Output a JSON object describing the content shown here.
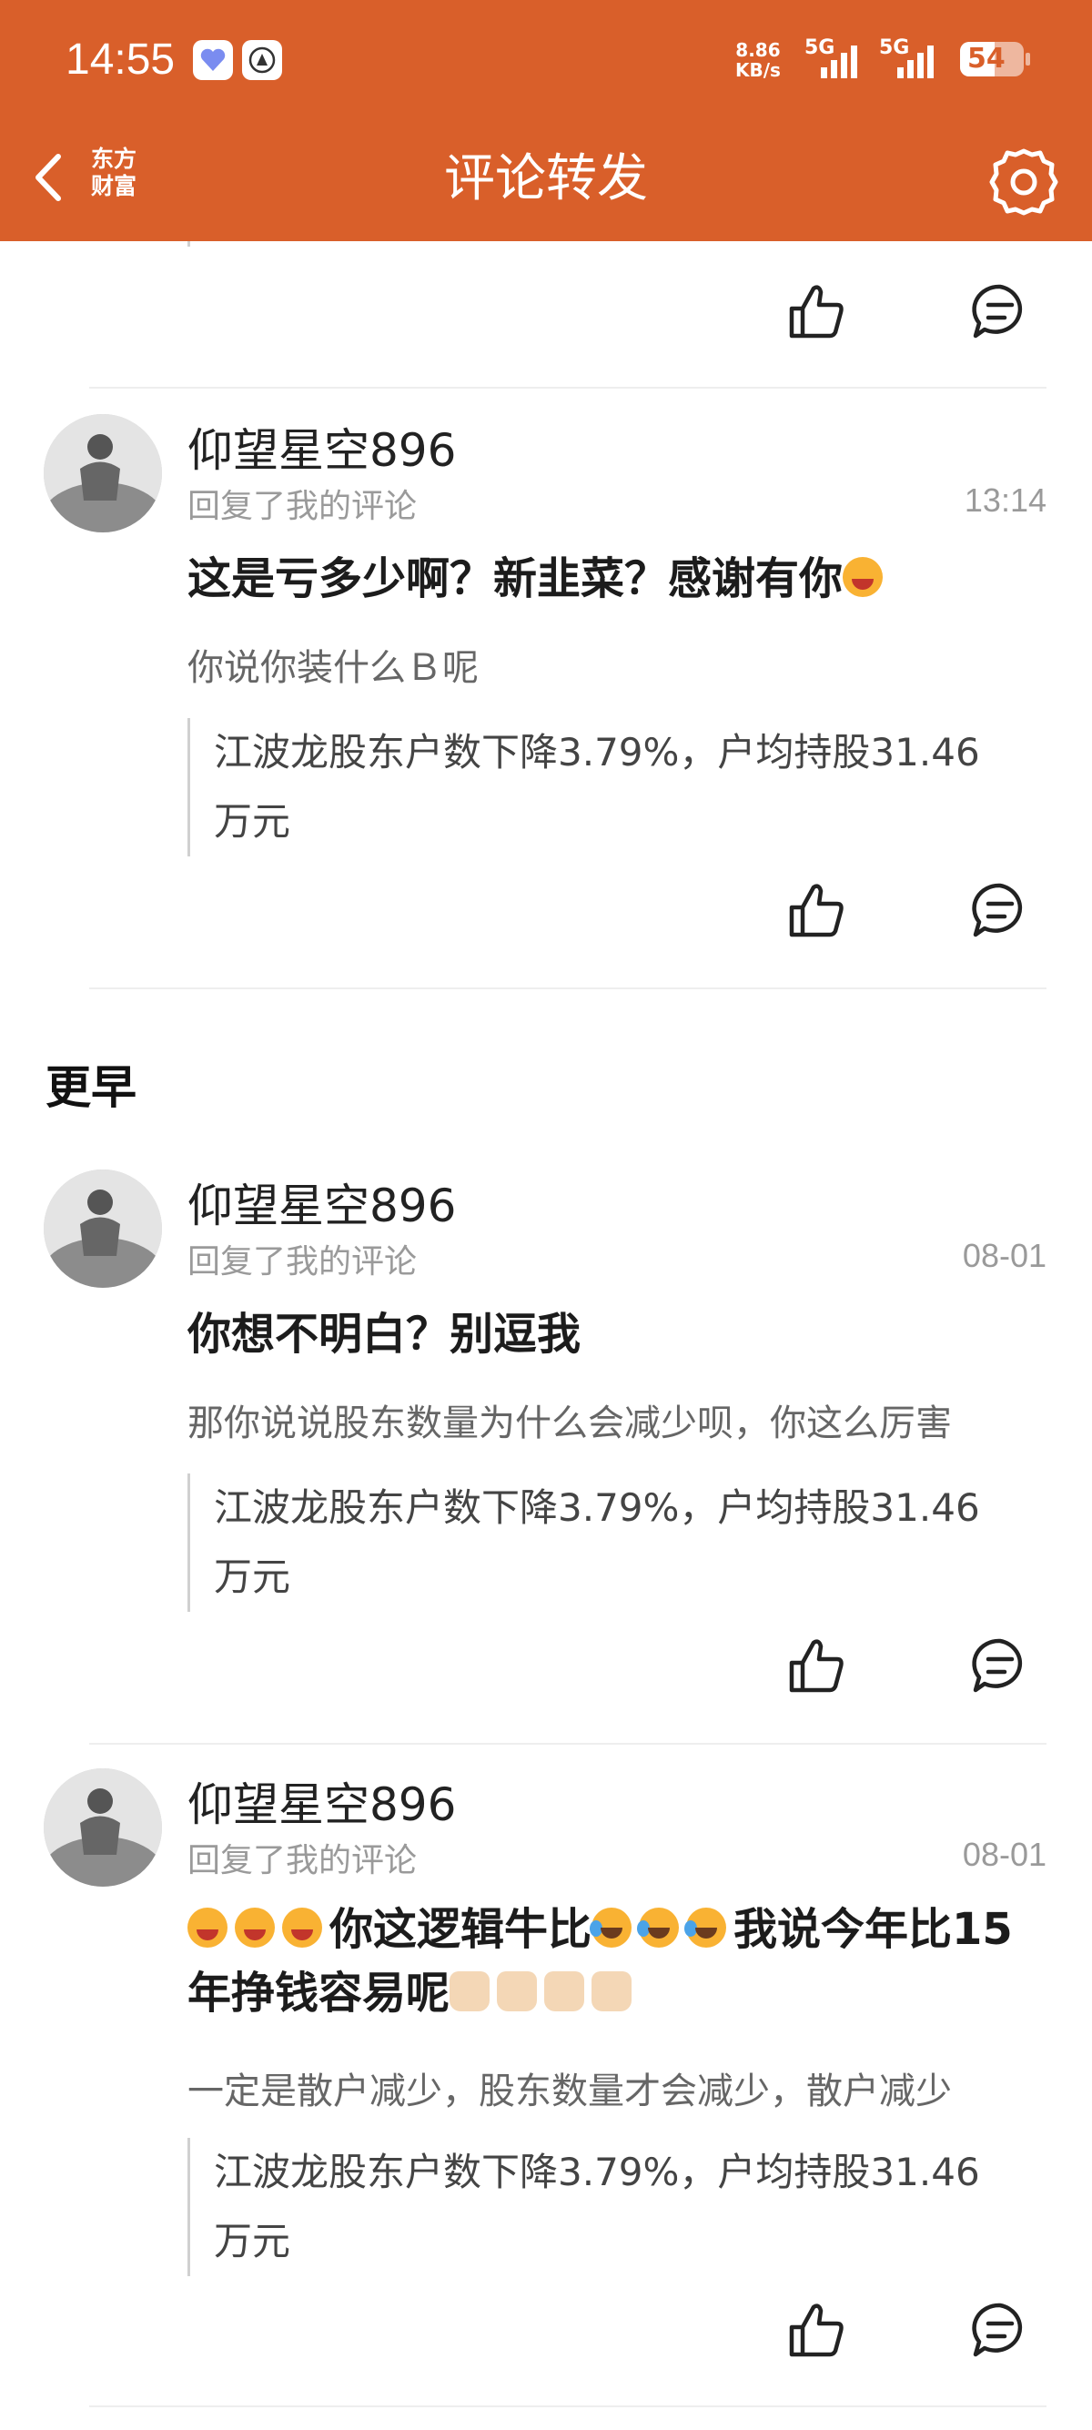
{
  "status_bar": {
    "time": "14:55",
    "net_speed_line1": "8.86",
    "net_speed_line2": "KB/s",
    "signal1_label": "5G",
    "signal2_label": "5G",
    "battery": "54"
  },
  "header": {
    "title": "评论转发",
    "logo_line1": "东方",
    "logo_line2": "财富",
    "accent_color": "#D95F2A"
  },
  "section_earlier": "更早",
  "comments": [
    {
      "name": "仰望星空896",
      "subtitle": "回复了我的评论",
      "date": "13:14",
      "reply": "这是亏多少啊？新韭菜？感谢有你",
      "original": "你说你装什么Ｂ呢",
      "quote_line1": "江波龙股东户数下降3.79%，户均持股31.46",
      "quote_line2": "万元"
    },
    {
      "name": "仰望星空896",
      "subtitle": "回复了我的评论",
      "date": "08-01",
      "reply": "你想不明白？别逗我",
      "original": "那你说说股东数量为什么会减少呗，你这么厉害",
      "quote_line1": "江波龙股东户数下降3.79%，户均持股31.46",
      "quote_line2": "万元"
    },
    {
      "name": "仰望星空896",
      "subtitle": "回复了我的评论",
      "date": "08-01",
      "reply_part1": "你这逻辑牛比",
      "reply_part2": "我说今年比15",
      "reply_line2": "年挣钱容易呢",
      "original": "一定是散户减少，股东数量才会减少，散户减少",
      "quote_line1": "江波龙股东户数下降3.79%，户均持股31.46",
      "quote_line2": "万元"
    }
  ]
}
